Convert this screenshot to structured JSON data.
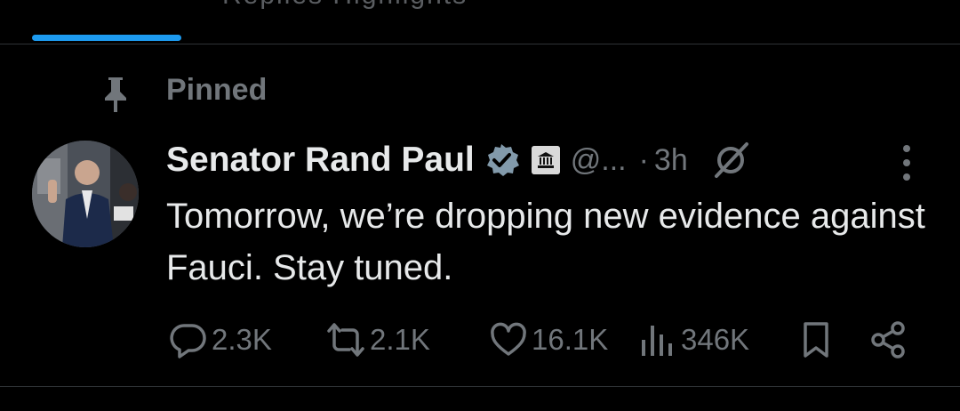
{
  "tabs": {
    "active_tab_partial": "Replies Highlights"
  },
  "pinned": {
    "label": "Pinned"
  },
  "tweet": {
    "author_name": "Senator Rand Paul",
    "handle": "@...",
    "separator": "·",
    "time": "3h",
    "text": "Tomorrow, we’re dropping new evidence against Fauci. Stay tuned.",
    "stats": {
      "replies": "2.3K",
      "reposts": "2.1K",
      "likes": "16.1K",
      "views": "346K"
    }
  },
  "colors": {
    "background": "#000000",
    "primary_text": "#e7e9ea",
    "secondary_text": "#71767b",
    "accent": "#1d9bf0",
    "divider": "#2f3336"
  },
  "icons": {
    "pin": "pin-icon",
    "verified": "verified-badge-icon",
    "government": "government-badge-icon",
    "grok": "grok-icon",
    "more": "more-options-icon",
    "reply": "reply-icon",
    "repost": "repost-icon",
    "like": "like-icon",
    "views": "views-icon",
    "bookmark": "bookmark-icon",
    "share": "share-icon"
  }
}
